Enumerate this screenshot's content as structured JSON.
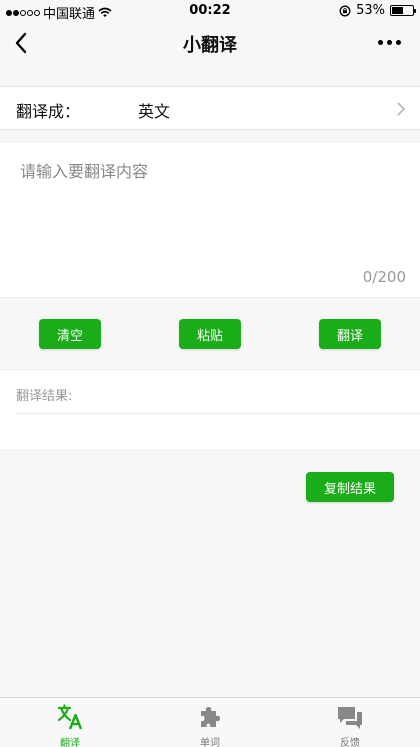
{
  "status_bar": {
    "carrier": "中国联通",
    "time": "00:22",
    "battery_text": "53%",
    "battery_level": 0.53
  },
  "nav": {
    "title": "小翻译",
    "back_icon": "chevron-left-icon",
    "more_icon": "more-dots-icon"
  },
  "target_language": {
    "label": "翻译成：",
    "value": "英文"
  },
  "input": {
    "placeholder": "请输入要翻译内容",
    "value": "",
    "counter": "0/200"
  },
  "actions": {
    "clear_label": "清空",
    "paste_label": "粘贴",
    "translate_label": "翻译"
  },
  "result": {
    "label": "翻译结果:",
    "text": "",
    "copy_label": "复制结果"
  },
  "tabs": [
    {
      "label": "翻译",
      "icon": "translate-icon",
      "active": true
    },
    {
      "label": "单词",
      "icon": "puzzle-icon",
      "active": false
    },
    {
      "label": "反馈",
      "icon": "chat-bubbles-icon",
      "active": false
    }
  ],
  "colors": {
    "accent": "#1aad19",
    "inactive_icon": "#888888"
  }
}
